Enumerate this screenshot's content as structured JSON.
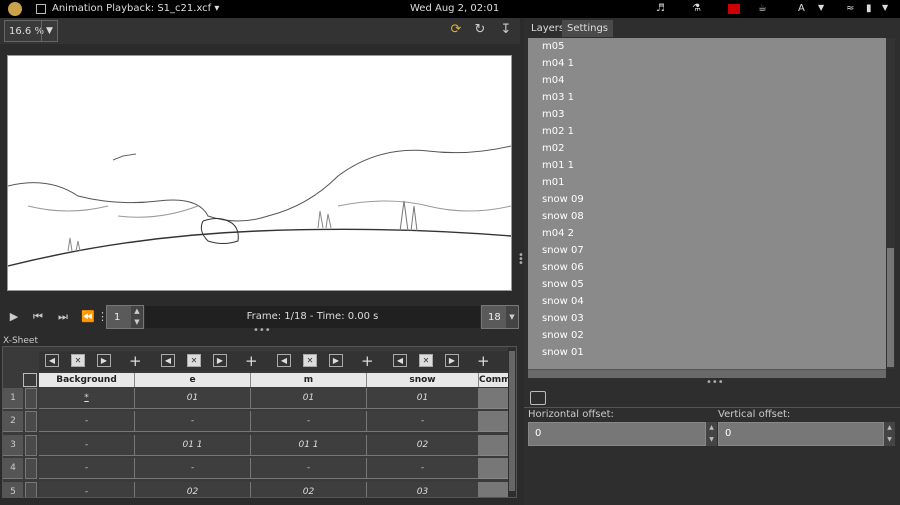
{
  "topbar": {
    "app_title": "Animation Playback: S1_c21.xcf ▾",
    "clock": "Wed Aug  2, 02:01",
    "keyboard_layout": "A"
  },
  "toolbar": {
    "zoom_value": "16.6 %",
    "icons": [
      "refresh-icon",
      "reload-icon",
      "export-icon"
    ]
  },
  "transport": {
    "current_frame": "1",
    "frame_info": "Frame: 1/18 - Time: 0.00 s",
    "end_frame": "18"
  },
  "xsheet": {
    "label": "X-Sheet",
    "columns": [
      "Background",
      "e",
      "m",
      "snow",
      "Comm"
    ],
    "rows": [
      {
        "num": "1",
        "cells": [
          "*",
          "01",
          "01",
          "01"
        ]
      },
      {
        "num": "2",
        "cells": [
          "-",
          "-",
          "-",
          "-"
        ]
      },
      {
        "num": "3",
        "cells": [
          "-",
          "01 1",
          "01 1",
          "02"
        ]
      },
      {
        "num": "4",
        "cells": [
          "-",
          "-",
          "-",
          "-"
        ]
      },
      {
        "num": "5",
        "cells": [
          "-",
          "02",
          "02",
          "03"
        ]
      }
    ]
  },
  "panel": {
    "tabs": [
      "Layers",
      "Settings"
    ],
    "layers": [
      "m05",
      "m04 1",
      "m04",
      "m03 1",
      "m03",
      "m02 1",
      "m02",
      "m01 1",
      "m01",
      "snow 09",
      "snow 08",
      "m04 2",
      "snow 07",
      "snow 06",
      "snow 05",
      "snow 04",
      "snow 03",
      "snow 02",
      "snow 01"
    ],
    "horizontal_offset_label": "Horizontal offset:",
    "horizontal_offset_value": "0",
    "vertical_offset_label": "Vertical offset:",
    "vertical_offset_value": "0"
  }
}
